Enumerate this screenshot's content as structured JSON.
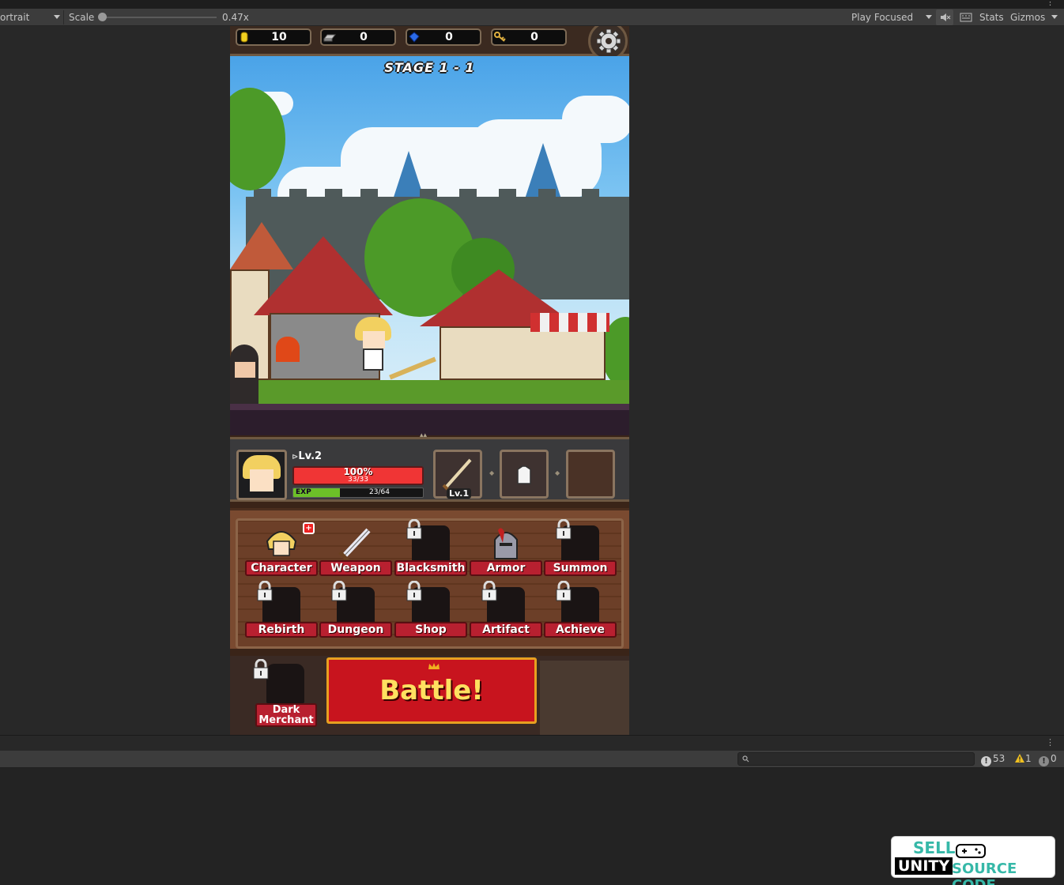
{
  "editor": {
    "aspect_label": "ortrait",
    "scale_label": "Scale",
    "scale_value": "0.47x",
    "scale_fraction": 0.0,
    "play_focused": "Play Focused",
    "stats": "Stats",
    "gizmos": "Gizmos"
  },
  "hud": {
    "resources": [
      {
        "icon": "gold-coin-icon",
        "value": "10",
        "color": "#f0d020"
      },
      {
        "icon": "iron-ingot-icon",
        "value": "0",
        "color": "#b8b8b8"
      },
      {
        "icon": "blue-gem-icon",
        "value": "0",
        "color": "#2a6ae8"
      },
      {
        "icon": "key-icon",
        "value": "0",
        "color": "#e0b040"
      }
    ]
  },
  "stage": {
    "title": "STAGE 1 - 1"
  },
  "character": {
    "level": "Lv.2",
    "hp_percent": "100%",
    "hp_value": "33/33",
    "exp_label": "EXP",
    "exp_value": "23/64",
    "exp_fraction": 0.36,
    "weapon_level": "Lv.1"
  },
  "menu": {
    "row1": [
      {
        "label": "Character",
        "locked": false
      },
      {
        "label": "Weapon",
        "locked": false
      },
      {
        "label": "Blacksmith",
        "locked": true
      },
      {
        "label": "Armor",
        "locked": false
      },
      {
        "label": "Summon",
        "locked": true
      }
    ],
    "row2": [
      {
        "label": "Rebirth",
        "locked": true
      },
      {
        "label": "Dungeon",
        "locked": true
      },
      {
        "label": "Shop",
        "locked": true
      },
      {
        "label": "Artifact",
        "locked": true
      },
      {
        "label": "Achieve",
        "locked": true
      }
    ],
    "character_badge": "+"
  },
  "battle": {
    "label": "Battle!",
    "dark_merchant_line1": "Dark",
    "dark_merchant_line2": "Merchant"
  },
  "console": {
    "search_placeholder": "",
    "log_count": "53",
    "warn_count": "1",
    "error_count": "0"
  },
  "watermark": {
    "sell": "SELL",
    "unity": "UNITY",
    "source": "SOURCE CODE"
  }
}
